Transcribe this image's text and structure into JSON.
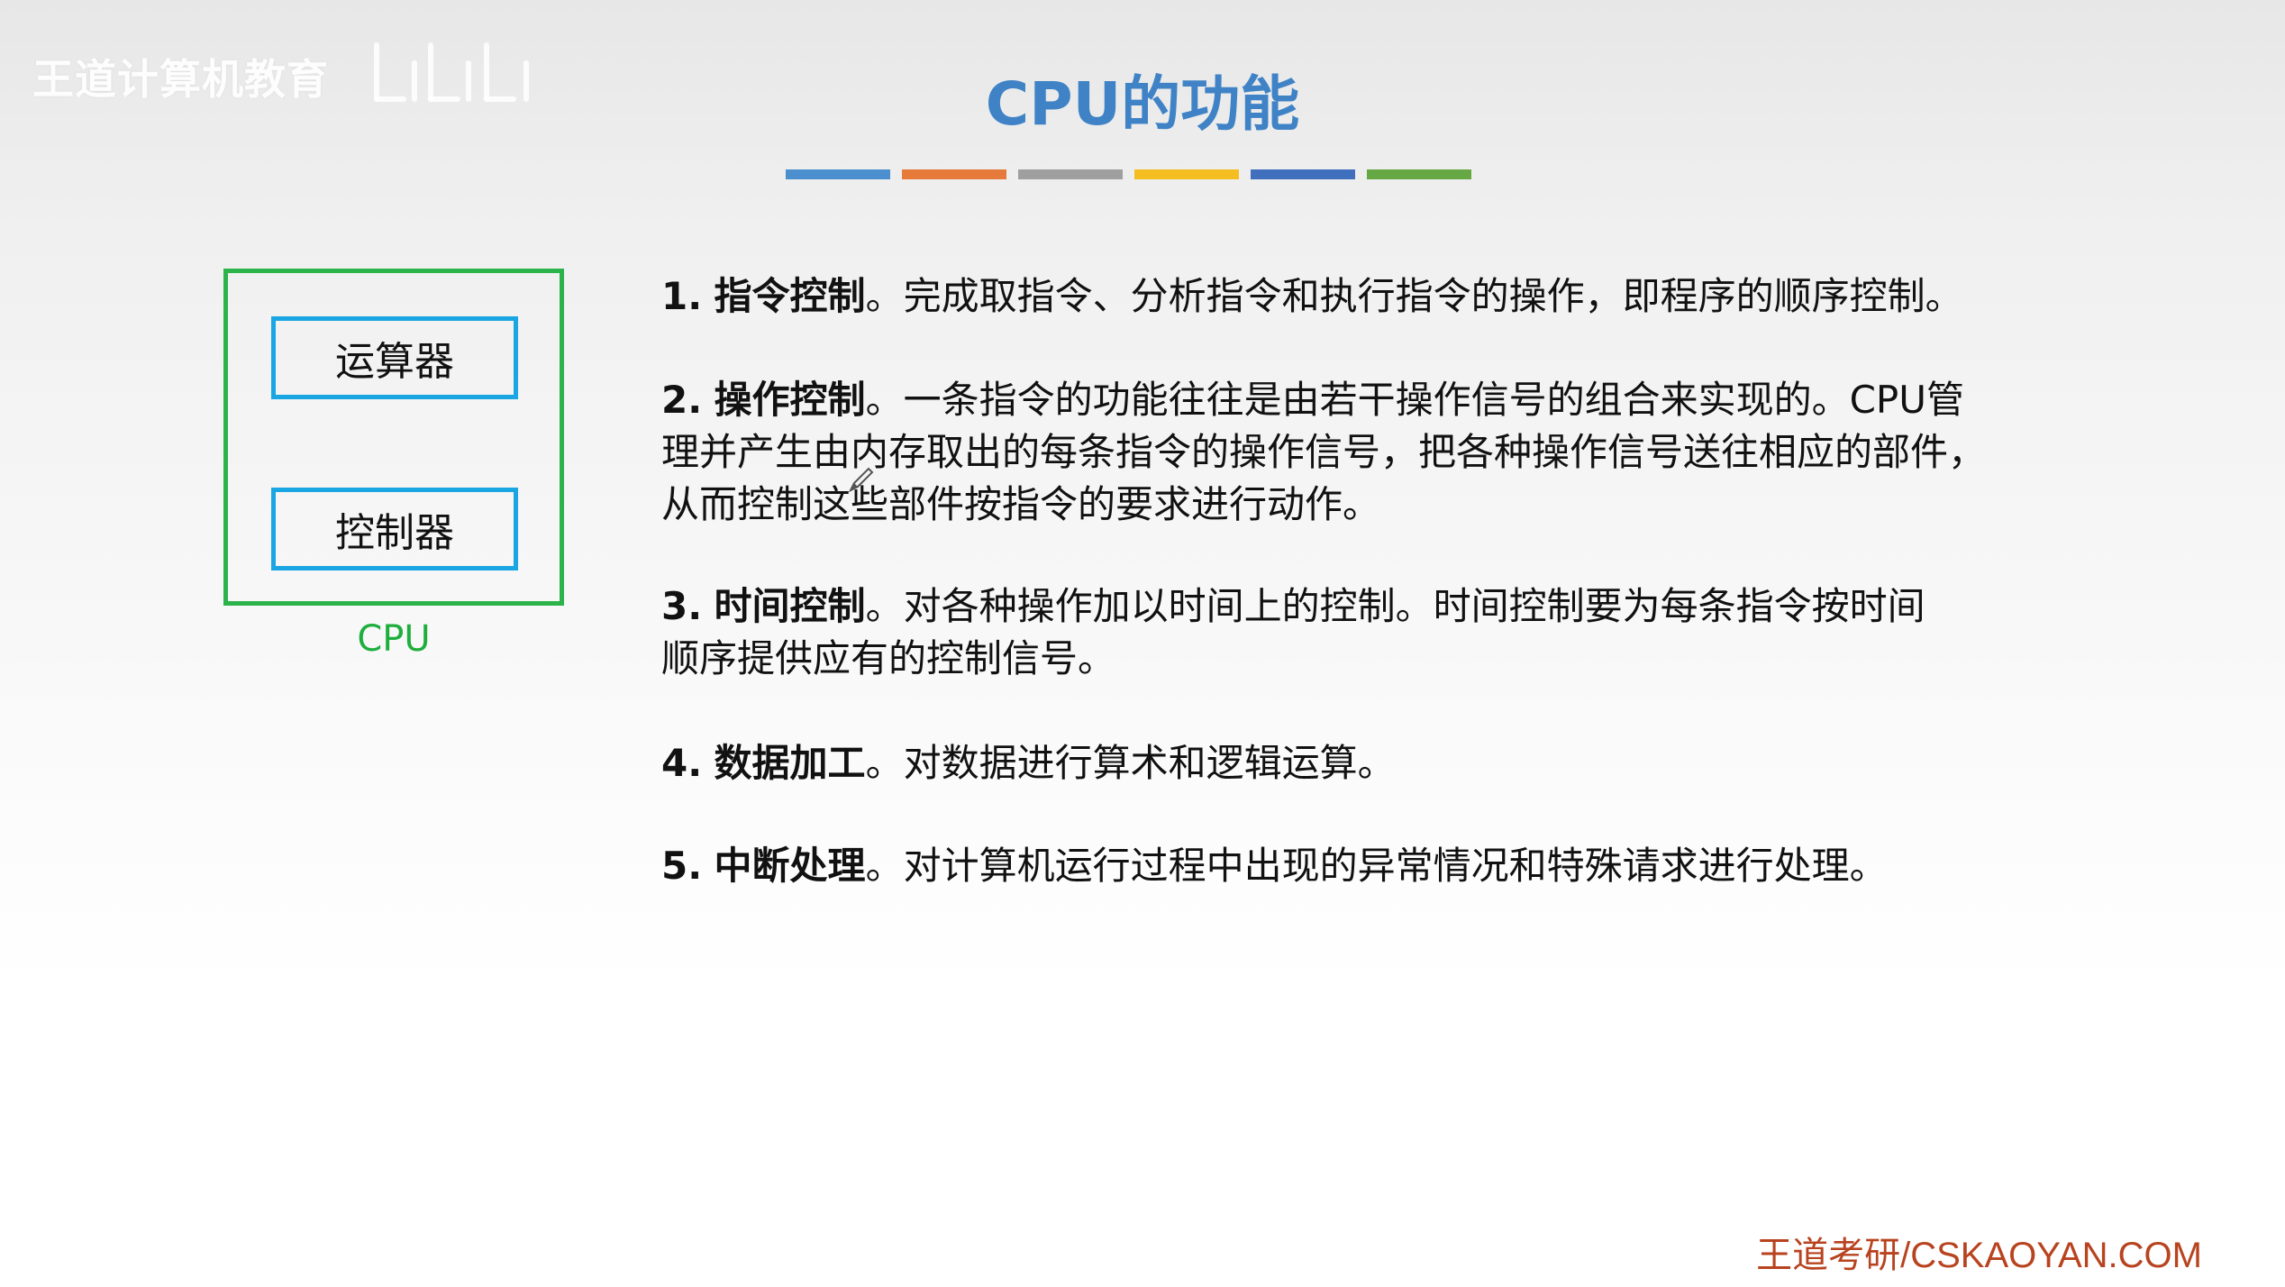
{
  "watermark": {
    "text": "王道计算机教育",
    "logo_icon": "bilibili-logo-icon"
  },
  "title": "CPU的功能",
  "color_bars": [
    "#4b8fcf",
    "#e67a3a",
    "#9f9f9f",
    "#f4be20",
    "#3f6fbd",
    "#65a844"
  ],
  "diagram": {
    "alu_label": "运算器",
    "control_label": "控制器",
    "cpu_label": "CPU",
    "border_color": "#2cb34a",
    "unit_border_color": "#1aa6e3"
  },
  "functions": [
    {
      "number": "1.",
      "name": "指令控制",
      "lines": [
        "。完成取指令、分析指令和执行指令的操作，即程序的顺序控制。"
      ]
    },
    {
      "number": "2.",
      "name": "操作控制",
      "lines": [
        "。一条指令的功能往往是由若干操作信号的组合来实现的。CPU管",
        "理并产生由内存取出的每条指令的操作信号，把各种操作信号送往相应的部件，",
        "从而控制这些部件按指令的要求进行动作。"
      ]
    },
    {
      "number": "3.",
      "name": "时间控制",
      "lines": [
        "。对各种操作加以时间上的控制。时间控制要为每条指令按时间",
        "顺序提供应有的控制信号。"
      ]
    },
    {
      "number": "4.",
      "name": "数据加工",
      "lines": [
        "。对数据进行算术和逻辑运算。"
      ]
    },
    {
      "number": "5.",
      "name": "中断处理",
      "lines": [
        "。对计算机运行过程中出现的异常情况和特殊请求进行处理。"
      ]
    }
  ],
  "footer": "王道考研/CSKAOYAN.COM"
}
